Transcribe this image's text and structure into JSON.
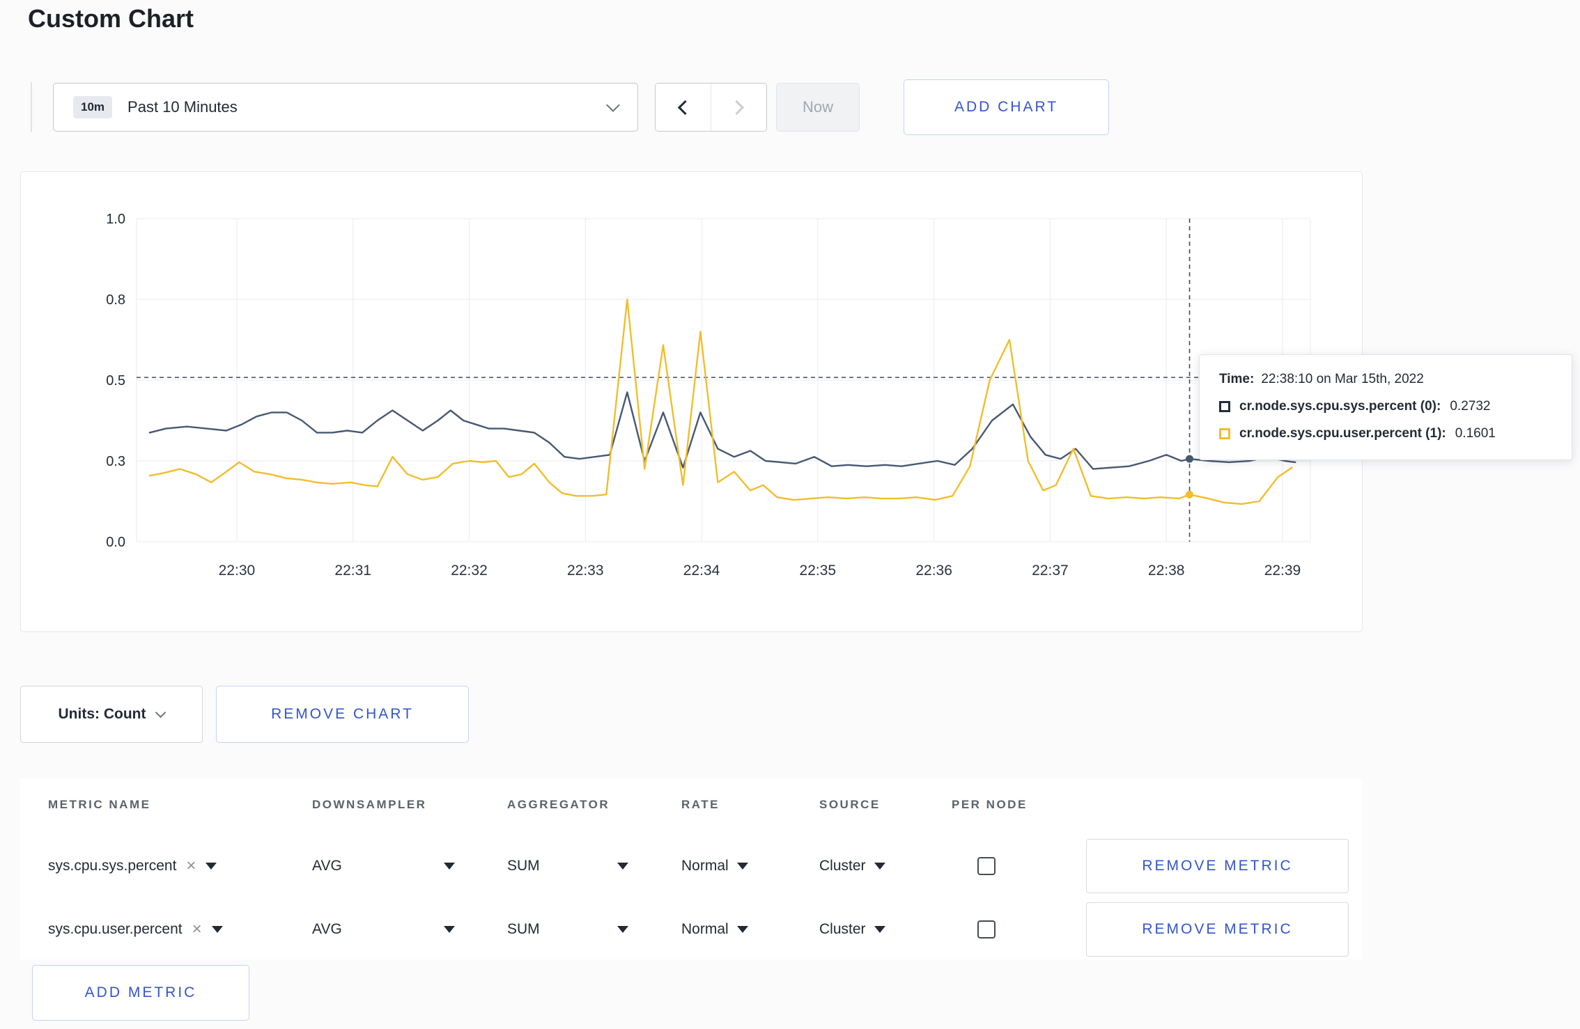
{
  "page": {
    "title": "Custom Chart"
  },
  "toolbar": {
    "time_badge": "10m",
    "time_label": "Past 10 Minutes",
    "now_label": "Now",
    "add_chart_label": "ADD CHART"
  },
  "chart_data": {
    "type": "line",
    "title": "",
    "xlabel": "",
    "ylabel": "",
    "grid": true,
    "legend_position": "tooltip",
    "y_ticks": {
      "values": [
        0.0,
        0.3,
        0.5,
        0.8,
        1.0
      ],
      "labels": [
        "0.0",
        "0.3",
        "0.5",
        "0.8",
        "1.0"
      ]
    },
    "x_ticks": {
      "minutes": [
        1,
        2,
        3,
        4,
        5,
        6,
        7,
        8,
        9,
        10
      ],
      "labels": [
        "22:30",
        "22:31",
        "22:32",
        "22:33",
        "22:34",
        "22:35",
        "22:36",
        "22:37",
        "22:38",
        "22:39"
      ]
    },
    "x_domain_minutes": [
      0.137,
      10.24
    ],
    "hline_value": 0.51,
    "crosshair_minute": 9.2,
    "series": [
      {
        "name": "cr.node.sys.cpu.sys.percent",
        "color": "#475872",
        "points": [
          [
            0.25,
            0.37
          ],
          [
            0.39,
            0.38
          ],
          [
            0.57,
            0.385
          ],
          [
            0.74,
            0.38
          ],
          [
            0.91,
            0.375
          ],
          [
            1.04,
            0.39
          ],
          [
            1.17,
            0.41
          ],
          [
            1.3,
            0.42
          ],
          [
            1.43,
            0.42
          ],
          [
            1.56,
            0.4
          ],
          [
            1.69,
            0.37
          ],
          [
            1.82,
            0.37
          ],
          [
            1.95,
            0.375
          ],
          [
            2.08,
            0.37
          ],
          [
            2.21,
            0.4
          ],
          [
            2.34,
            0.425
          ],
          [
            2.47,
            0.4
          ],
          [
            2.6,
            0.375
          ],
          [
            2.73,
            0.4
          ],
          [
            2.84,
            0.425
          ],
          [
            2.95,
            0.4
          ],
          [
            3.06,
            0.39
          ],
          [
            3.17,
            0.38
          ],
          [
            3.3,
            0.38
          ],
          [
            3.43,
            0.375
          ],
          [
            3.56,
            0.37
          ],
          [
            3.69,
            0.345
          ],
          [
            3.82,
            0.31
          ],
          [
            3.95,
            0.305
          ],
          [
            4.08,
            0.31
          ],
          [
            4.21,
            0.315
          ],
          [
            4.36,
            0.47
          ],
          [
            4.51,
            0.3
          ],
          [
            4.67,
            0.42
          ],
          [
            4.84,
            0.275
          ],
          [
            4.99,
            0.42
          ],
          [
            5.14,
            0.33
          ],
          [
            5.28,
            0.31
          ],
          [
            5.42,
            0.325
          ],
          [
            5.55,
            0.3
          ],
          [
            5.68,
            0.295
          ],
          [
            5.81,
            0.29
          ],
          [
            5.97,
            0.31
          ],
          [
            6.12,
            0.28
          ],
          [
            6.26,
            0.285
          ],
          [
            6.42,
            0.28
          ],
          [
            6.58,
            0.285
          ],
          [
            6.72,
            0.28
          ],
          [
            6.87,
            0.29
          ],
          [
            7.03,
            0.3
          ],
          [
            7.18,
            0.285
          ],
          [
            7.33,
            0.33
          ],
          [
            7.5,
            0.4
          ],
          [
            7.68,
            0.44
          ],
          [
            7.83,
            0.36
          ],
          [
            7.96,
            0.315
          ],
          [
            8.09,
            0.305
          ],
          [
            8.22,
            0.33
          ],
          [
            8.37,
            0.27
          ],
          [
            8.52,
            0.275
          ],
          [
            8.68,
            0.28
          ],
          [
            8.85,
            0.3
          ],
          [
            9.0,
            0.315
          ],
          [
            9.13,
            0.3
          ],
          [
            9.2,
            0.305
          ],
          [
            9.37,
            0.3
          ],
          [
            9.54,
            0.295
          ],
          [
            9.72,
            0.3
          ],
          [
            9.87,
            0.31
          ],
          [
            10.02,
            0.3
          ],
          [
            10.11,
            0.295
          ]
        ]
      },
      {
        "name": "cr.node.sys.cpu.user.percent",
        "color": "#f2bd2d",
        "points": [
          [
            0.25,
            0.245
          ],
          [
            0.37,
            0.255
          ],
          [
            0.51,
            0.27
          ],
          [
            0.65,
            0.25
          ],
          [
            0.78,
            0.22
          ],
          [
            0.91,
            0.26
          ],
          [
            1.02,
            0.295
          ],
          [
            1.15,
            0.26
          ],
          [
            1.29,
            0.25
          ],
          [
            1.43,
            0.235
          ],
          [
            1.56,
            0.23
          ],
          [
            1.69,
            0.22
          ],
          [
            1.82,
            0.215
          ],
          [
            1.98,
            0.22
          ],
          [
            2.1,
            0.21
          ],
          [
            2.21,
            0.205
          ],
          [
            2.34,
            0.31
          ],
          [
            2.47,
            0.25
          ],
          [
            2.6,
            0.23
          ],
          [
            2.73,
            0.24
          ],
          [
            2.86,
            0.29
          ],
          [
            3.0,
            0.3
          ],
          [
            3.12,
            0.295
          ],
          [
            3.23,
            0.3
          ],
          [
            3.34,
            0.24
          ],
          [
            3.45,
            0.25
          ],
          [
            3.56,
            0.29
          ],
          [
            3.69,
            0.22
          ],
          [
            3.8,
            0.18
          ],
          [
            3.92,
            0.17
          ],
          [
            4.06,
            0.17
          ],
          [
            4.18,
            0.175
          ],
          [
            4.36,
            0.8
          ],
          [
            4.51,
            0.27
          ],
          [
            4.67,
            0.63
          ],
          [
            4.84,
            0.21
          ],
          [
            4.99,
            0.68
          ],
          [
            5.14,
            0.22
          ],
          [
            5.28,
            0.26
          ],
          [
            5.42,
            0.19
          ],
          [
            5.53,
            0.21
          ],
          [
            5.65,
            0.165
          ],
          [
            5.79,
            0.155
          ],
          [
            5.94,
            0.16
          ],
          [
            6.09,
            0.165
          ],
          [
            6.25,
            0.16
          ],
          [
            6.4,
            0.165
          ],
          [
            6.55,
            0.16
          ],
          [
            6.7,
            0.16
          ],
          [
            6.85,
            0.165
          ],
          [
            7.01,
            0.155
          ],
          [
            7.16,
            0.17
          ],
          [
            7.31,
            0.28
          ],
          [
            7.48,
            0.5
          ],
          [
            7.65,
            0.65
          ],
          [
            7.81,
            0.3
          ],
          [
            7.94,
            0.19
          ],
          [
            8.05,
            0.21
          ],
          [
            8.2,
            0.33
          ],
          [
            8.35,
            0.17
          ],
          [
            8.5,
            0.16
          ],
          [
            8.66,
            0.165
          ],
          [
            8.81,
            0.16
          ],
          [
            8.95,
            0.165
          ],
          [
            9.11,
            0.16
          ],
          [
            9.2,
            0.175
          ],
          [
            9.36,
            0.16
          ],
          [
            9.5,
            0.145
          ],
          [
            9.65,
            0.14
          ],
          [
            9.8,
            0.15
          ],
          [
            9.96,
            0.24
          ],
          [
            10.08,
            0.275
          ]
        ]
      }
    ]
  },
  "tooltip": {
    "time_label": "Time:",
    "time_value": "22:38:10 on Mar 15th, 2022",
    "rows": [
      {
        "label": "cr.node.sys.cpu.sys.percent (0):",
        "value": "0.2732",
        "color": "#222c3f"
      },
      {
        "label": "cr.node.sys.cpu.user.percent (1):",
        "value": "0.1601",
        "color": "#f2bd2d"
      }
    ]
  },
  "chart_controls": {
    "units_label": "Units: Count",
    "remove_chart_label": "REMOVE CHART"
  },
  "metrics_table": {
    "headers": [
      "METRIC NAME",
      "DOWNSAMPLER",
      "AGGREGATOR",
      "RATE",
      "SOURCE",
      "PER NODE"
    ],
    "rows": [
      {
        "metric": "sys.cpu.sys.percent",
        "downsampler": "AVG",
        "aggregator": "SUM",
        "rate": "Normal",
        "source": "Cluster",
        "per_node_checked": false,
        "remove_label": "REMOVE METRIC"
      },
      {
        "metric": "sys.cpu.user.percent",
        "downsampler": "AVG",
        "aggregator": "SUM",
        "rate": "Normal",
        "source": "Cluster",
        "per_node_checked": false,
        "remove_label": "REMOVE METRIC"
      }
    ],
    "add_metric_label": "ADD METRIC"
  },
  "colors": {
    "accent_blue": "#3454cf",
    "series_sys": "#475872",
    "series_user": "#f2bd2d",
    "crosshair": "#3d4a63"
  }
}
